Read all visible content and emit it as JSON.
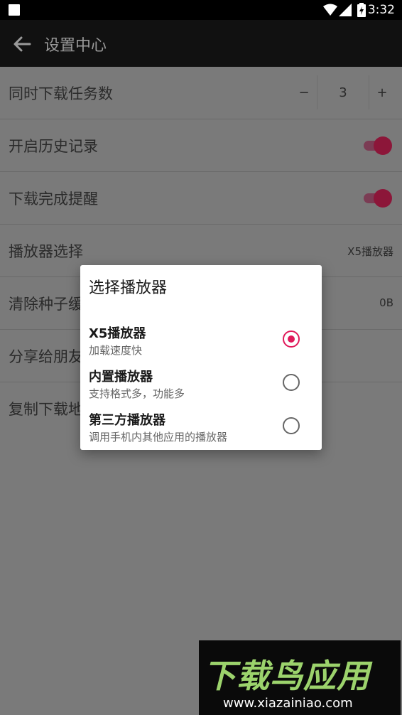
{
  "status_bar": {
    "time": "3:32"
  },
  "app_bar": {
    "title": "设置中心"
  },
  "settings": {
    "concurrent_downloads": {
      "label": "同时下载任务数",
      "minus": "−",
      "value": "3",
      "plus": "+"
    },
    "history": {
      "label": "开启历史记录",
      "enabled": true
    },
    "download_reminder": {
      "label": "下载完成提醒",
      "enabled": true
    },
    "player_select": {
      "label": "播放器选择",
      "value": "X5播放器"
    },
    "clear_cache": {
      "label": "清除种子缓",
      "value": "0B"
    },
    "share": {
      "label": "分享给朋友"
    },
    "copy_link": {
      "label": "复制下载地"
    }
  },
  "dialog": {
    "title": "选择播放器",
    "options": [
      {
        "title": "X5播放器",
        "subtitle": "加载速度快",
        "selected": true
      },
      {
        "title": "内置播放器",
        "subtitle": "支持格式多，功能多",
        "selected": false
      },
      {
        "title": "第三方播放器",
        "subtitle": "调用手机内其他应用的播放器",
        "selected": false
      }
    ]
  },
  "watermark": {
    "logo": "下载鸟应用",
    "url": "www.xiazainiao.com"
  },
  "colors": {
    "accent": "#e0195a",
    "app_bar": "#111111",
    "overlay_bg": "#7a7a7a"
  }
}
